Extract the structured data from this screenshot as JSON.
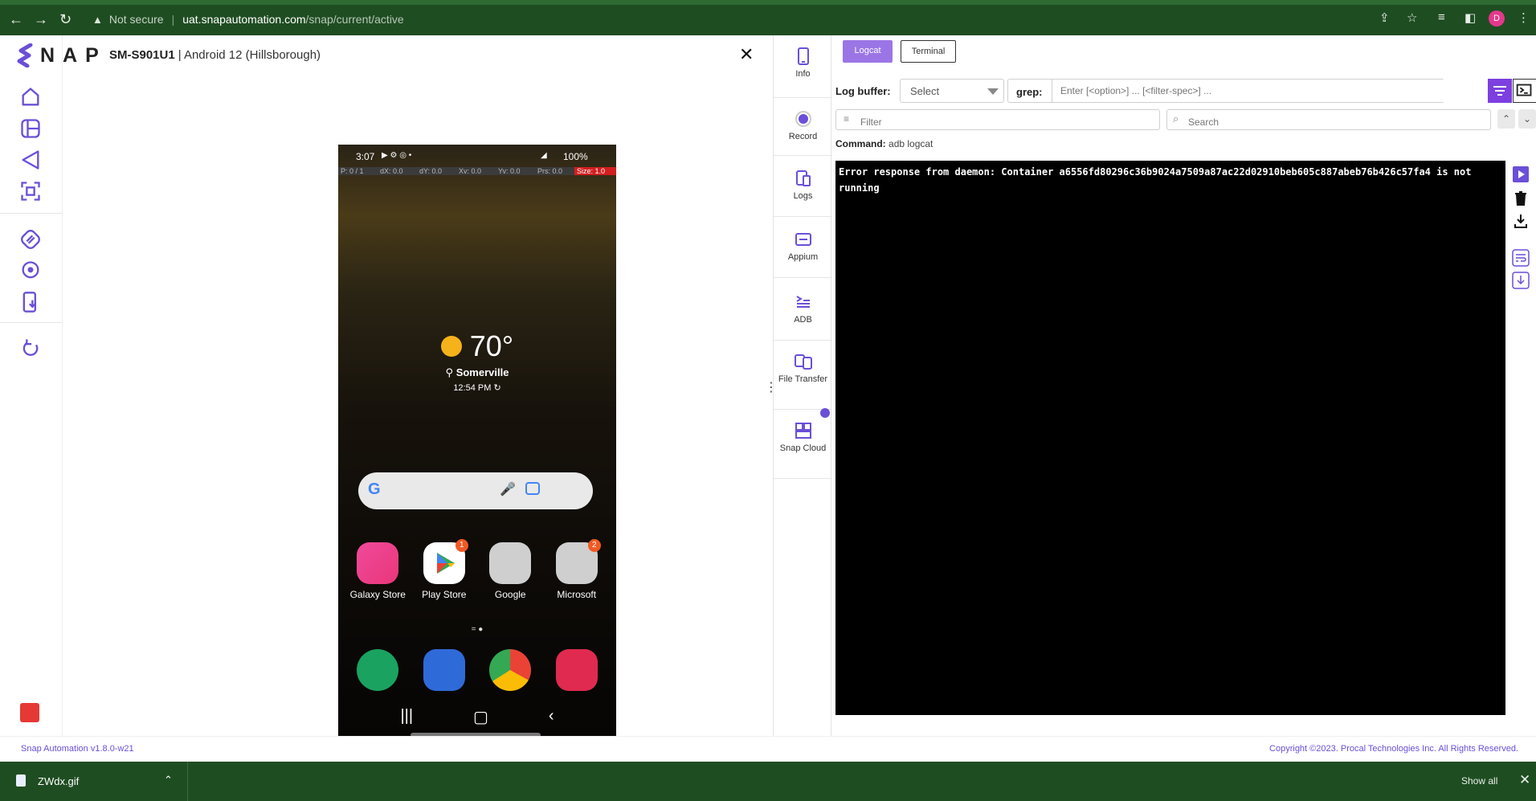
{
  "browser": {
    "security_label": "Not secure",
    "url_host": "uat.snapautomation.com",
    "url_path": "/snap/current/active",
    "profile_initial": "D"
  },
  "app": {
    "logo_text": "NAP",
    "device_model": "SM-S901U1",
    "device_os": "| Android 12 (Hillsborough)",
    "close_symbol": "✕"
  },
  "phone": {
    "status_time": "3:07",
    "battery": "100%",
    "pointer_bar": [
      "P: 0 / 1",
      "dX: 0.0",
      "dY: 0.0",
      "Xv: 0.0",
      "Yv: 0.0",
      "Prs: 0.0",
      "Size: 1.0"
    ],
    "temperature": "70°",
    "city": "Somerville",
    "clock": "12:54 PM",
    "apps": [
      {
        "label": "Galaxy Store",
        "color": "#e9367a"
      },
      {
        "label": "Play Store",
        "color": "#ffffff",
        "badge": "1"
      },
      {
        "label": "Google",
        "color": "#c9c9c9"
      },
      {
        "label": "Microsoft",
        "color": "#c9c9c9",
        "badge": "2"
      }
    ],
    "dock_colors": [
      "#1aa260",
      "#2f6ad9",
      "#ffffff",
      "#e02a4f"
    ]
  },
  "tools": [
    {
      "label": "Info"
    },
    {
      "label": "Record"
    },
    {
      "label": "Logs"
    },
    {
      "label": "Appium"
    },
    {
      "label": "ADB"
    },
    {
      "label": "File Transfer"
    },
    {
      "label": "Snap Cloud"
    }
  ],
  "logcat": {
    "tab_logcat": "Logcat",
    "tab_terminal": "Terminal",
    "log_buffer_label": "Log buffer:",
    "log_buffer_value": "Select",
    "grep_label": "grep:",
    "grep_placeholder": "Enter [<option>] ... [<filter-spec>] ...",
    "filter_placeholder": "Filter",
    "search_placeholder": "Search",
    "command_label": "Command:",
    "command_value": "adb logcat",
    "console_text": "Error response from daemon: Container a6556fd80296c36b9024a7509a87ac22d02910beb605c887abeb76b426c57fa4 is not running"
  },
  "footer": {
    "version": "Snap Automation v1.8.0-w21",
    "copyright": "Copyright ©2023. Procal Technologies Inc. All Rights Reserved."
  },
  "downloads": {
    "file_name": "ZWdx.gif",
    "show_all": "Show all"
  },
  "colors": {
    "accent": "#6b4fd8",
    "chrome": "#1f4d22"
  }
}
